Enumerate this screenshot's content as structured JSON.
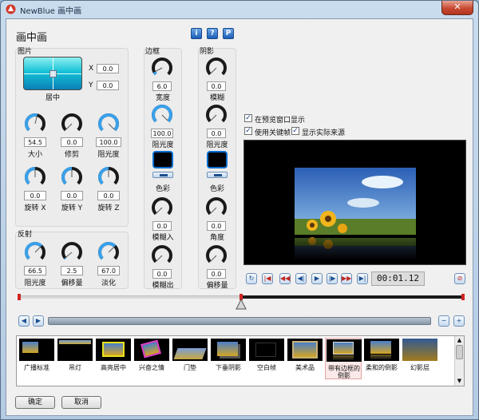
{
  "window": {
    "title": "NewBlue 画中画",
    "close": "✕"
  },
  "panel": {
    "title": "画中画"
  },
  "help": {
    "info": "i",
    "question": "?",
    "preset": "P"
  },
  "picture": {
    "label": "图片",
    "pos_label": "居中",
    "x_label": "X",
    "x_value": "0.0",
    "y_label": "Y",
    "y_value": "0.0",
    "knobs": [
      {
        "label": "大小",
        "value": "54.5",
        "level": 0.55
      },
      {
        "label": "修剪",
        "value": "0.0",
        "level": 0.0
      },
      {
        "label": "阻光度",
        "value": "100.0",
        "level": 1.0
      },
      {
        "label": "旋转 X",
        "value": "0.0",
        "level": 0.5
      },
      {
        "label": "旋转 Y",
        "value": "0.0",
        "level": 0.5
      },
      {
        "label": "旋转 Z",
        "value": "0.0",
        "level": 0.5
      }
    ]
  },
  "reflection": {
    "label": "反射",
    "knobs": [
      {
        "label": "阻光度",
        "value": "66.5",
        "level": 0.665
      },
      {
        "label": "偏移量",
        "value": "2.5",
        "level": 0.02
      },
      {
        "label": "淡化",
        "value": "67.0",
        "level": 0.67
      }
    ]
  },
  "border": {
    "label": "边框",
    "width": {
      "label": "宽度",
      "value": "6.0",
      "level": 0.06
    },
    "opacity": {
      "label": "阻光度",
      "value": "100.0",
      "level": 1.0
    },
    "color_label": "色彩",
    "color": "#000000",
    "blur_in": {
      "label": "模糊入",
      "value": "0.0",
      "level": 0.0
    },
    "blur_out": {
      "label": "模糊出",
      "value": "0.0",
      "level": 0.0
    }
  },
  "shadow": {
    "label": "阴影",
    "blur": {
      "label": "模糊",
      "value": "0.0",
      "level": 0.0
    },
    "opacity": {
      "label": "阻光度",
      "value": "0.0",
      "level": 0.0
    },
    "color_label": "色彩",
    "color": "#000000",
    "angle": {
      "label": "角度",
      "value": "0.0",
      "level": 0.0
    },
    "offset": {
      "label": "偏移量",
      "value": "0.0",
      "level": 0.0
    }
  },
  "preview": {
    "show_in_window": "在预览窗口显示",
    "use_keyframes": "使用关键帧",
    "show_actual_source": "显示实际来源"
  },
  "transport": {
    "timecode": "00:01.12",
    "buttons": [
      "loop-icon",
      "go-start-icon",
      "prev-key-icon",
      "step-back-icon",
      "play-icon",
      "step-forward-icon",
      "next-key-icon",
      "go-end-icon"
    ]
  },
  "timeline": {
    "playhead_position": 0.5
  },
  "presets": [
    {
      "label": "广播标准"
    },
    {
      "label": "吊灯"
    },
    {
      "label": "高亮居中"
    },
    {
      "label": "兴奋之情"
    },
    {
      "label": "门垫"
    },
    {
      "label": "下垂阴影"
    },
    {
      "label": "空白帧"
    },
    {
      "label": "美术品"
    },
    {
      "label": "带有边框的倒影"
    },
    {
      "label": "柔和的倒影"
    },
    {
      "label": "幻影层"
    }
  ],
  "footer": {
    "ok": "确定",
    "cancel": "取消"
  },
  "colors": {
    "knob_active": "#3aa0ea",
    "knob_track": "#1a1a1a",
    "accent": "#0b6fd1"
  }
}
